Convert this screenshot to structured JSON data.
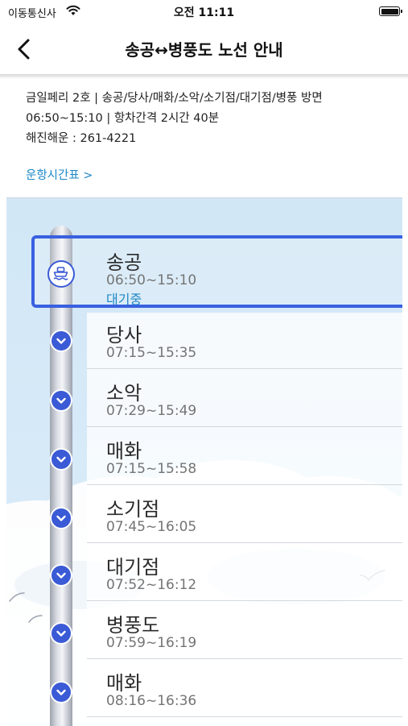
{
  "status_bar": {
    "carrier": "이동통신사",
    "time": "오전 11:11"
  },
  "nav": {
    "title": "송공↔병풍도 노선 안내"
  },
  "info": {
    "line1": "금일페리 2호 | 송공/당사/매화/소악/소기점/대기점/병풍 방면",
    "line2": "06:50~15:10 | 항차간격 2시간 40분",
    "line3": "해진해운 : 261-4221",
    "schedule_link": "운항시간표 >"
  },
  "stops": [
    {
      "name": "송공",
      "time": "06:50~15:10",
      "status": "대기중",
      "current": true
    },
    {
      "name": "당사",
      "time": "07:15~15:35"
    },
    {
      "name": "소악",
      "time": "07:29~15:49"
    },
    {
      "name": "매화",
      "time": "07:15~15:58"
    },
    {
      "name": "소기점",
      "time": "07:45~16:05"
    },
    {
      "name": "대기점",
      "time": "07:52~16:12"
    },
    {
      "name": "병풍도",
      "time": "07:59~16:19"
    },
    {
      "name": "매화",
      "time": "08:16~16:36"
    }
  ],
  "icons": {
    "back": "chevron-left-icon",
    "current_stop": "ship-icon",
    "stop_node": "chevron-down-icon"
  },
  "colors": {
    "accent": "#3a5ad6",
    "link": "#1e88c8",
    "sky": "#d5e9f7"
  }
}
